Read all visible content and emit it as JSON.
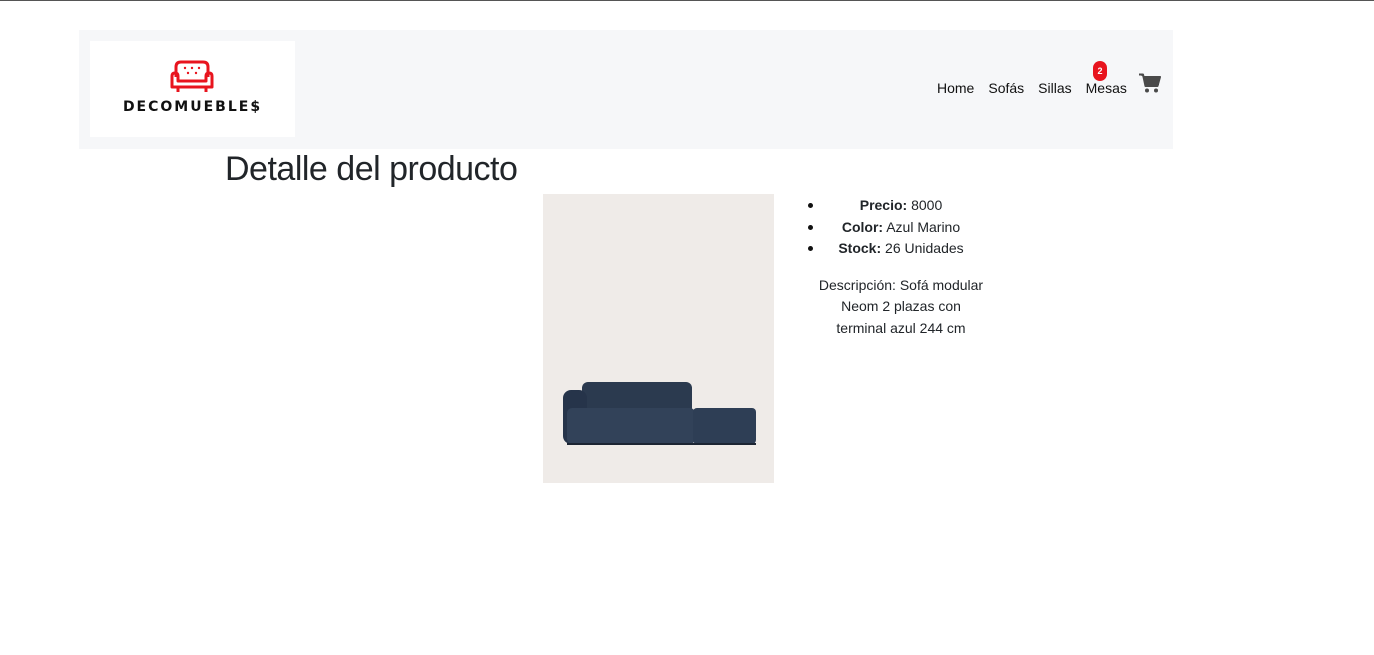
{
  "brand": {
    "name": "DECOMUEBLE$",
    "logo_icon": "sofa-icon",
    "accent_color": "#e8141e"
  },
  "nav": {
    "links": [
      "Home",
      "Sofás",
      "Sillas",
      "Mesas"
    ],
    "cart_icon": "cart-icon",
    "cart_count": "2"
  },
  "page": {
    "title": "Detalle del producto"
  },
  "product": {
    "image_icon": "sofa-product-image",
    "price_label": "Precio:",
    "price_value": "8000",
    "color_label": "Color:",
    "color_value": "Azul Marino",
    "stock_label": "Stock:",
    "stock_value": "26 Unidades",
    "description": "Descripción: Sofá modular Neom 2 plazas con terminal azul 244 cm"
  }
}
